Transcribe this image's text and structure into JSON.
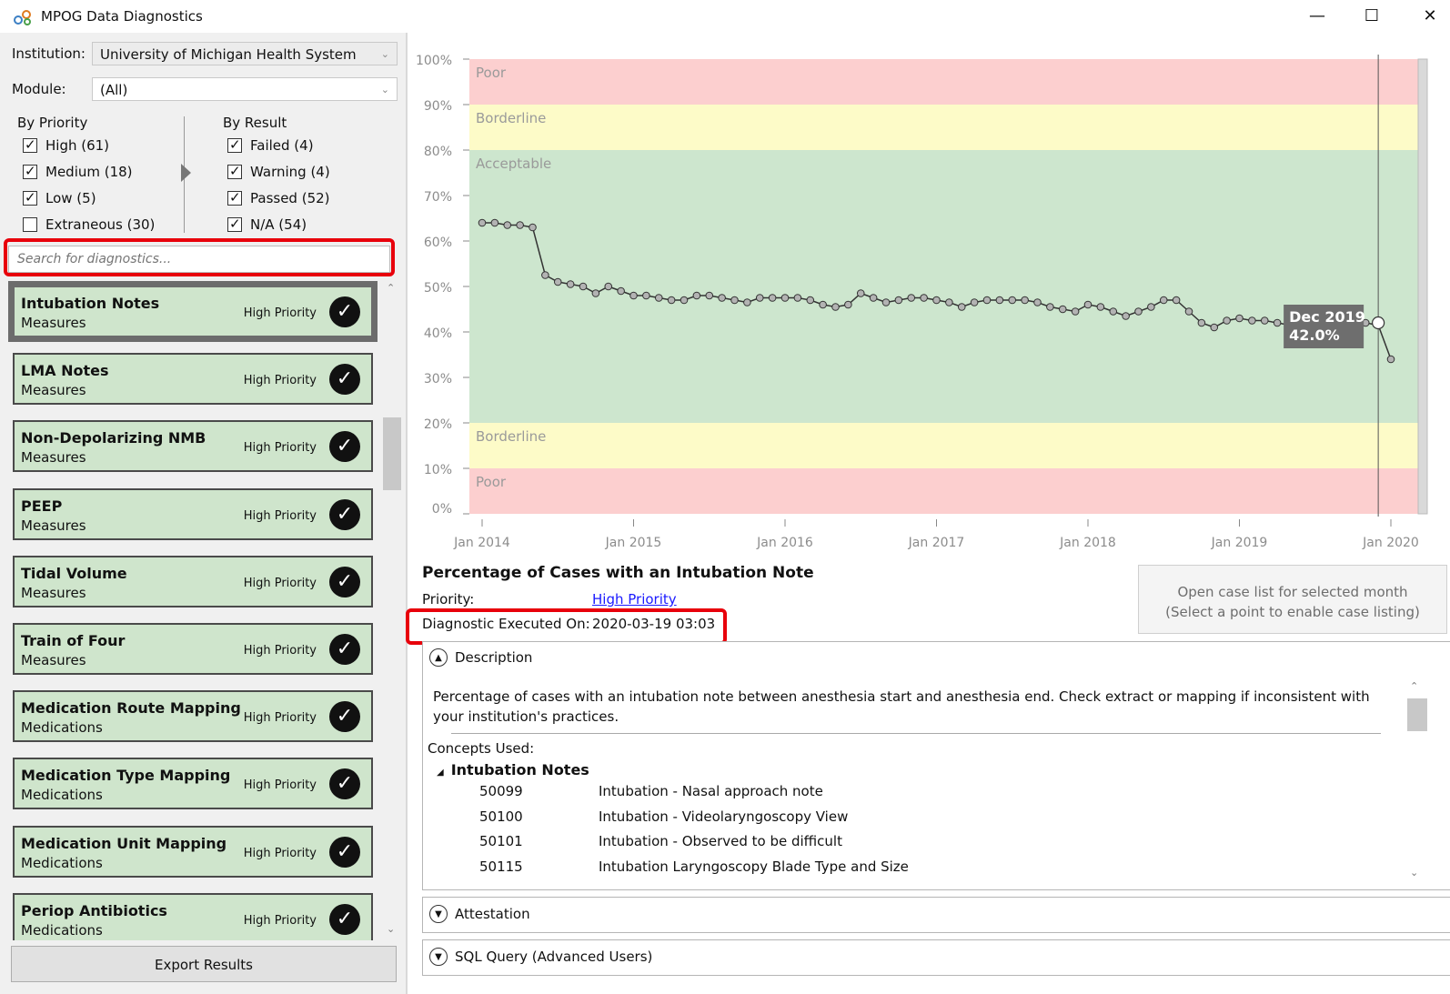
{
  "window": {
    "title": "MPOG Data Diagnostics",
    "minimize": "—",
    "maximize": "☐",
    "close": "✕"
  },
  "filters": {
    "institution_label": "Institution:",
    "institution_value": "University of Michigan Health System",
    "module_label": "Module:",
    "module_value": "(All)",
    "by_priority_header": "By Priority",
    "by_result_header": "By Result",
    "priority": [
      {
        "label": "High (61)",
        "checked": true
      },
      {
        "label": "Medium (18)",
        "checked": true
      },
      {
        "label": "Low (5)",
        "checked": true
      },
      {
        "label": "Extraneous (30)",
        "checked": false
      }
    ],
    "result": [
      {
        "label": "Failed (4)",
        "checked": true
      },
      {
        "label": "Warning (4)",
        "checked": true
      },
      {
        "label": "Passed (52)",
        "checked": true
      },
      {
        "label": "N/A (54)",
        "checked": true
      }
    ],
    "search_placeholder": "Search for diagnostics..."
  },
  "diagnostics": [
    {
      "name": "Intubation Notes",
      "category": "Measures",
      "priority": "High Priority",
      "icon": "check-icon",
      "selected": true
    },
    {
      "name": "LMA Notes",
      "category": "Measures",
      "priority": "High Priority",
      "icon": "check-icon"
    },
    {
      "name": "Non-Depolarizing NMB",
      "category": "Measures",
      "priority": "High Priority",
      "icon": "check-icon"
    },
    {
      "name": "PEEP",
      "category": "Measures",
      "priority": "High Priority",
      "icon": "check-icon"
    },
    {
      "name": "Tidal Volume",
      "category": "Measures",
      "priority": "High Priority",
      "icon": "check-icon"
    },
    {
      "name": "Train of Four",
      "category": "Measures",
      "priority": "High Priority",
      "icon": "check-icon"
    },
    {
      "name": "Medication Route Mapping",
      "category": "Medications",
      "priority": "High Priority",
      "icon": "check-icon"
    },
    {
      "name": "Medication Type Mapping",
      "category": "Medications",
      "priority": "High Priority",
      "icon": "check-icon"
    },
    {
      "name": "Medication Unit Mapping",
      "category": "Medications",
      "priority": "High Priority",
      "icon": "check-icon"
    },
    {
      "name": "Periop Antibiotics",
      "category": "Medications",
      "priority": "High Priority",
      "icon": "check-icon"
    }
  ],
  "export_button": "Export Results",
  "chart_data": {
    "type": "line",
    "xlabel": "",
    "ylabel": "",
    "ylim": [
      0,
      100
    ],
    "y_ticks": [
      "0%",
      "10%",
      "20%",
      "30%",
      "40%",
      "50%",
      "60%",
      "70%",
      "80%",
      "90%",
      "100%"
    ],
    "x_ticks": [
      "Jan 2014",
      "Jan 2015",
      "Jan 2016",
      "Jan 2017",
      "Jan 2018",
      "Jan 2019",
      "Jan 2020"
    ],
    "bands": [
      {
        "label": "Poor",
        "from": 90,
        "to": 100,
        "color": "#fccfcf"
      },
      {
        "label": "Borderline",
        "from": 80,
        "to": 90,
        "color": "#fdfbc8"
      },
      {
        "label": "Acceptable",
        "from": 20,
        "to": 80,
        "color": "#cde6ce"
      },
      {
        "label": "Borderline",
        "from": 10,
        "to": 20,
        "color": "#fdfbc8"
      },
      {
        "label": "Poor",
        "from": 0,
        "to": 10,
        "color": "#fccfcf"
      }
    ],
    "series": [
      {
        "start": "2014-01",
        "values": [
          64,
          64,
          63.5,
          63.5,
          63,
          52.5,
          51,
          50.5,
          50,
          48.5,
          50,
          49,
          48,
          48,
          47.5,
          47,
          47,
          48,
          48,
          47.5,
          47,
          46.5,
          47.5,
          47.5,
          47.5,
          47.5,
          47,
          46,
          45.5,
          46,
          48.5,
          47.5,
          46.5,
          47,
          47.5,
          47.5,
          47,
          46.5,
          45.5,
          46.5,
          47,
          47,
          47,
          47,
          46.5,
          45.5,
          45,
          44.5,
          46,
          45.5,
          44.5,
          43.5,
          44.5,
          45.5,
          47,
          47,
          44.5,
          42,
          41,
          42.5,
          43,
          42.5,
          42.5,
          42,
          41.5,
          41.5,
          42,
          42,
          42,
          42,
          42,
          41.5,
          34
        ]
      }
    ],
    "tooltip": {
      "date": "Dec 2019",
      "value": "42.0%",
      "x": "2019-12",
      "y": 42.0
    }
  },
  "details": {
    "title": "Percentage of Cases with an Intubation Note",
    "priority_label": "Priority:",
    "priority_value": "High Priority",
    "executed_label": "Diagnostic Executed On:",
    "executed_value": "2020-03-19 03:03",
    "case_button_line1": "Open case list for selected month",
    "case_button_line2": "(Select a point to enable case listing)",
    "description_header": "Description",
    "description_text": "Percentage of cases with an intubation note between anesthesia start and anesthesia end. Check extract or mapping if inconsistent with your institution's practices.",
    "concepts_label": "Concepts Used:",
    "concept_group": "Intubation Notes",
    "concepts": [
      {
        "id": "50099",
        "desc": "Intubation - Nasal approach note"
      },
      {
        "id": "50100",
        "desc": "Intubation - Videolaryngoscopy View"
      },
      {
        "id": "50101",
        "desc": "Intubation - Observed to be difficult"
      },
      {
        "id": "50115",
        "desc": "Intubation Laryngoscopy Blade Type and Size"
      }
    ],
    "attestation_header": "Attestation",
    "sql_header": "SQL Query (Advanced Users)"
  }
}
